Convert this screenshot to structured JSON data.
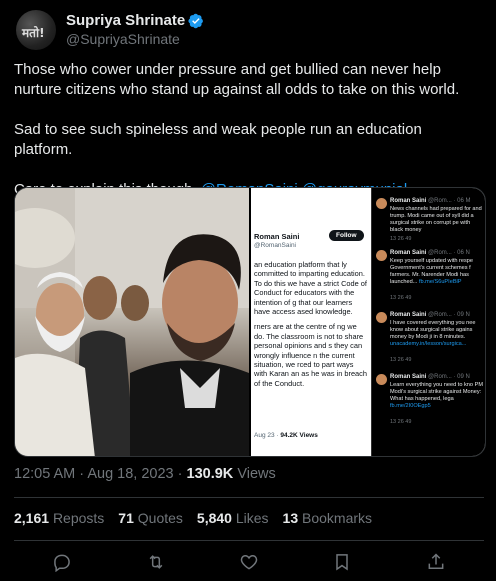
{
  "author": {
    "name": "Supriya Shrinate",
    "handle": "@SupriyaShrinate",
    "avatar_text": "मतो!"
  },
  "tweet": {
    "para1": "Those who cower under pressure and get bullied can never help nurture citizens who stand up against all odds to take on this world.",
    "para2": "Sad to see such spineless and weak people run an education platform.",
    "para3_text": "Care to explain this though",
    "mention1": "@RomanSaini",
    "mention2": "@gauravmunjal"
  },
  "screenshot": {
    "name": "Roman Saini",
    "handle": "@RomanSaini",
    "follow_label": "Follow",
    "body1": "an education platform that ly committed to imparting education. To do this we have a strict Code of Conduct for educators with the intention of g that our learners have access ased knowledge.",
    "body2": "rners are at the centre of ng we do. The classroom is not to share personal opinions and s they can wrongly influence n the current situation, we rced to part ways with Karan an as he was in breach of the Conduct.",
    "meta_date": "Aug 23 ·",
    "meta_views": "94.2K Views",
    "posts": [
      {
        "name": "Roman Saini",
        "meta": "@Rom... · 06 M",
        "text": "News channels had prepared for and trump. Modi came out of syll did a surgical strike on corrupt pe with black money",
        "link": "",
        "stats": "13   26   49"
      },
      {
        "name": "Roman Saini",
        "meta": "@Rom... · 06 N",
        "text": "Keep yourself updated with respe Government's current schemes f farmers. Mr. Narender Modi has launched...",
        "link": "fb.me/S6uPIeBlP",
        "stats": "13   26   49"
      },
      {
        "name": "Roman Saini",
        "meta": "@Rom... · 09 N",
        "text": "I have covered everything you nee know about surgical strike agains money by Modi ji in 8 minutes.",
        "link": "unacademy.in/lesson/surgica...",
        "stats": "13   26   49"
      },
      {
        "name": "Roman Saini",
        "meta": "@Rom... · 09 N",
        "text": "Learn everything you need to kno PM Modi's surgical strike against Money: What has happened, lega",
        "link": "fb.me/2I0OEgp5",
        "stats": "13   26   49"
      }
    ]
  },
  "timestamp": {
    "time": "12:05 AM · Aug 18, 2023 ·",
    "views_count": "130.9K",
    "views_label": "Views"
  },
  "stats": {
    "reposts_count": "2,161",
    "reposts_label": "Reposts",
    "quotes_count": "71",
    "quotes_label": "Quotes",
    "likes_count": "5,840",
    "likes_label": "Likes",
    "bookmarks_count": "13",
    "bookmarks_label": "Bookmarks"
  },
  "colors": {
    "background": "#000000",
    "text": "#e7e9ea",
    "muted": "#71767b",
    "link": "#1d9bf0",
    "border": "#2f3336"
  },
  "icons": [
    "verified-badge-icon",
    "reply-icon",
    "repost-icon",
    "like-icon",
    "bookmark-icon",
    "share-icon"
  ]
}
